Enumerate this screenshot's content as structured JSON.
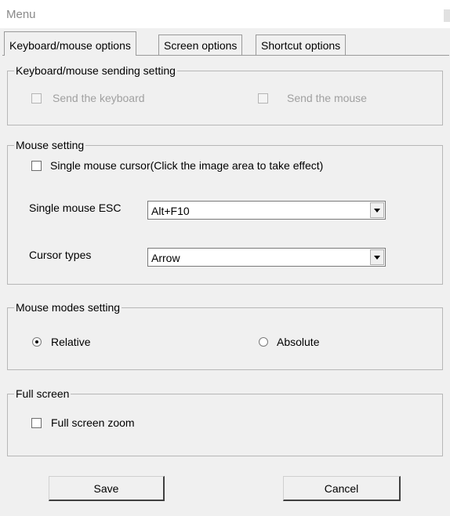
{
  "window": {
    "title": "Menu"
  },
  "tabs": [
    {
      "label": "Keyboard/mouse options",
      "active": true
    },
    {
      "label": "Screen options",
      "active": false
    },
    {
      "label": "Shortcut options",
      "active": false
    }
  ],
  "keyboard_mouse_sending": {
    "legend": "Keyboard/mouse sending setting",
    "send_keyboard": {
      "label": "Send the keyboard",
      "checked": false,
      "enabled": false
    },
    "send_mouse": {
      "label": "Send the mouse",
      "checked": false,
      "enabled": false
    }
  },
  "mouse_setting": {
    "legend": "Mouse setting",
    "single_cursor": {
      "label": "Single mouse cursor(Click the image area to take effect)",
      "checked": false
    },
    "single_mouse_esc": {
      "label": "Single mouse ESC",
      "value": "Alt+F10"
    },
    "cursor_types": {
      "label": "Cursor types",
      "value": "Arrow"
    }
  },
  "mouse_modes": {
    "legend": "Mouse modes setting",
    "options": [
      {
        "label": "Relative",
        "selected": true
      },
      {
        "label": "Absolute",
        "selected": false
      }
    ]
  },
  "full_screen": {
    "legend": "Full screen",
    "zoom": {
      "label": "Full screen zoom",
      "checked": false
    }
  },
  "buttons": {
    "save": "Save",
    "cancel": "Cancel"
  }
}
